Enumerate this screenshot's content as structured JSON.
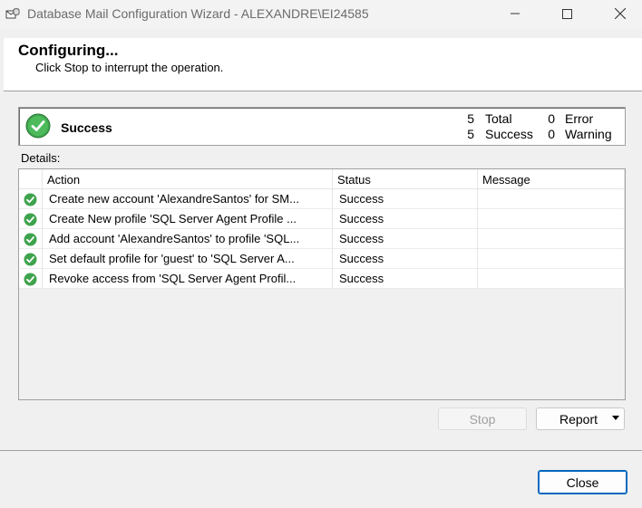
{
  "window": {
    "title": "Database Mail Configuration Wizard - ALEXANDRE\\EI24585"
  },
  "header": {
    "title": "Configuring...",
    "subtitle": "Click Stop to interrupt the operation."
  },
  "summary": {
    "status": "Success",
    "total_count": "5",
    "total_label": "Total",
    "success_count": "5",
    "success_label": "Success",
    "error_count": "0",
    "error_label": "Error",
    "warning_count": "0",
    "warning_label": "Warning"
  },
  "details": {
    "label": "Details:",
    "columns": [
      "Action",
      "Status",
      "Message"
    ],
    "rows": [
      {
        "action": "Create new account 'AlexandreSantos' for SM...",
        "status": "Success",
        "message": ""
      },
      {
        "action": "Create New profile 'SQL Server Agent Profile ...",
        "status": "Success",
        "message": ""
      },
      {
        "action": "Add account 'AlexandreSantos' to profile 'SQL...",
        "status": "Success",
        "message": ""
      },
      {
        "action": "Set default profile for 'guest' to 'SQL Server A...",
        "status": "Success",
        "message": ""
      },
      {
        "action": "Revoke access from 'SQL Server Agent Profil...",
        "status": "Success",
        "message": ""
      }
    ]
  },
  "buttons": {
    "stop": "Stop",
    "report": "Report",
    "close": "Close"
  },
  "colors": {
    "success_green": "#3fa34d",
    "accent_blue": "#0067c0"
  },
  "icons": {
    "app": "database-mail-icon",
    "status": "success-check-icon",
    "row": "success-check-icon"
  }
}
